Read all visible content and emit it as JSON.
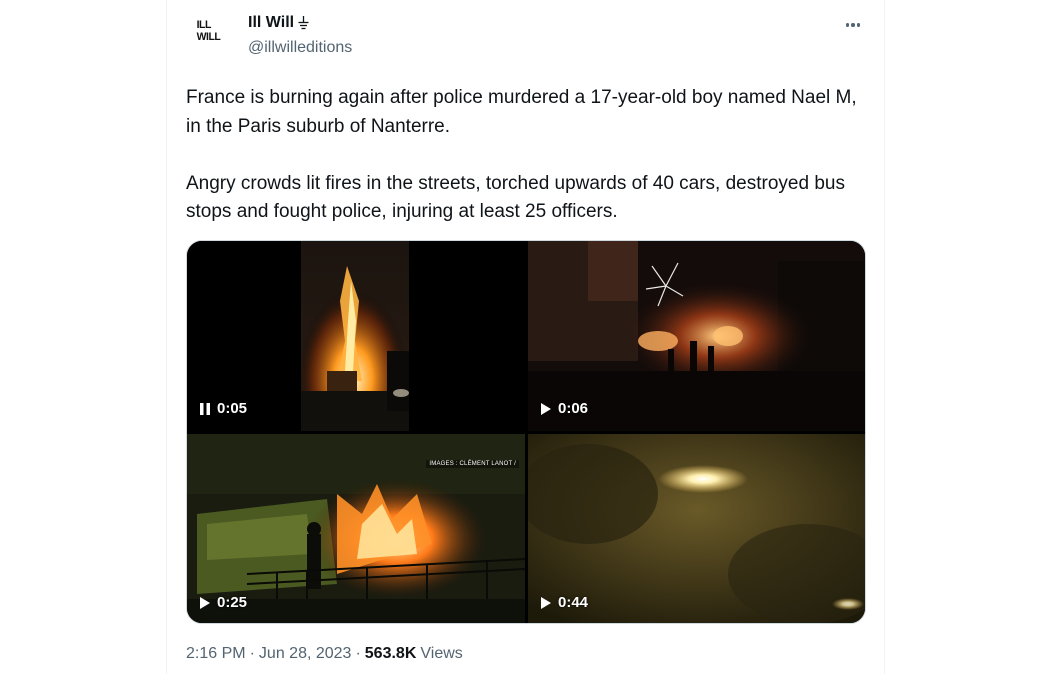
{
  "tweet": {
    "avatar_text": [
      "ILL",
      "WILL"
    ],
    "display_name": "Ill Will",
    "handle": "@illwilleditions",
    "text": "France is burning again after police murdered a 17-year-old boy named Nael M, in the Paris suburb of Nanterre.\n\nAngry crowds lit fires in the streets, torched upwards of 40 cars, destroyed bus stops and fought police, injuring at least 25 officers.",
    "media": [
      {
        "state": "pause-icon",
        "duration": "0:05"
      },
      {
        "state": "play-icon",
        "duration": "0:06"
      },
      {
        "state": "play-icon",
        "duration": "0:25",
        "credit": "IMAGES : CLÉMENT LANOT /"
      },
      {
        "state": "play-icon",
        "duration": "0:44"
      }
    ],
    "time": "2:16 PM",
    "date": "Jun 28, 2023",
    "separator": "·",
    "views_count": "563.8K",
    "views_label": "Views"
  },
  "colors": {
    "text": "#0f1419",
    "secondary": "#536471",
    "border": "#cfd9de"
  }
}
